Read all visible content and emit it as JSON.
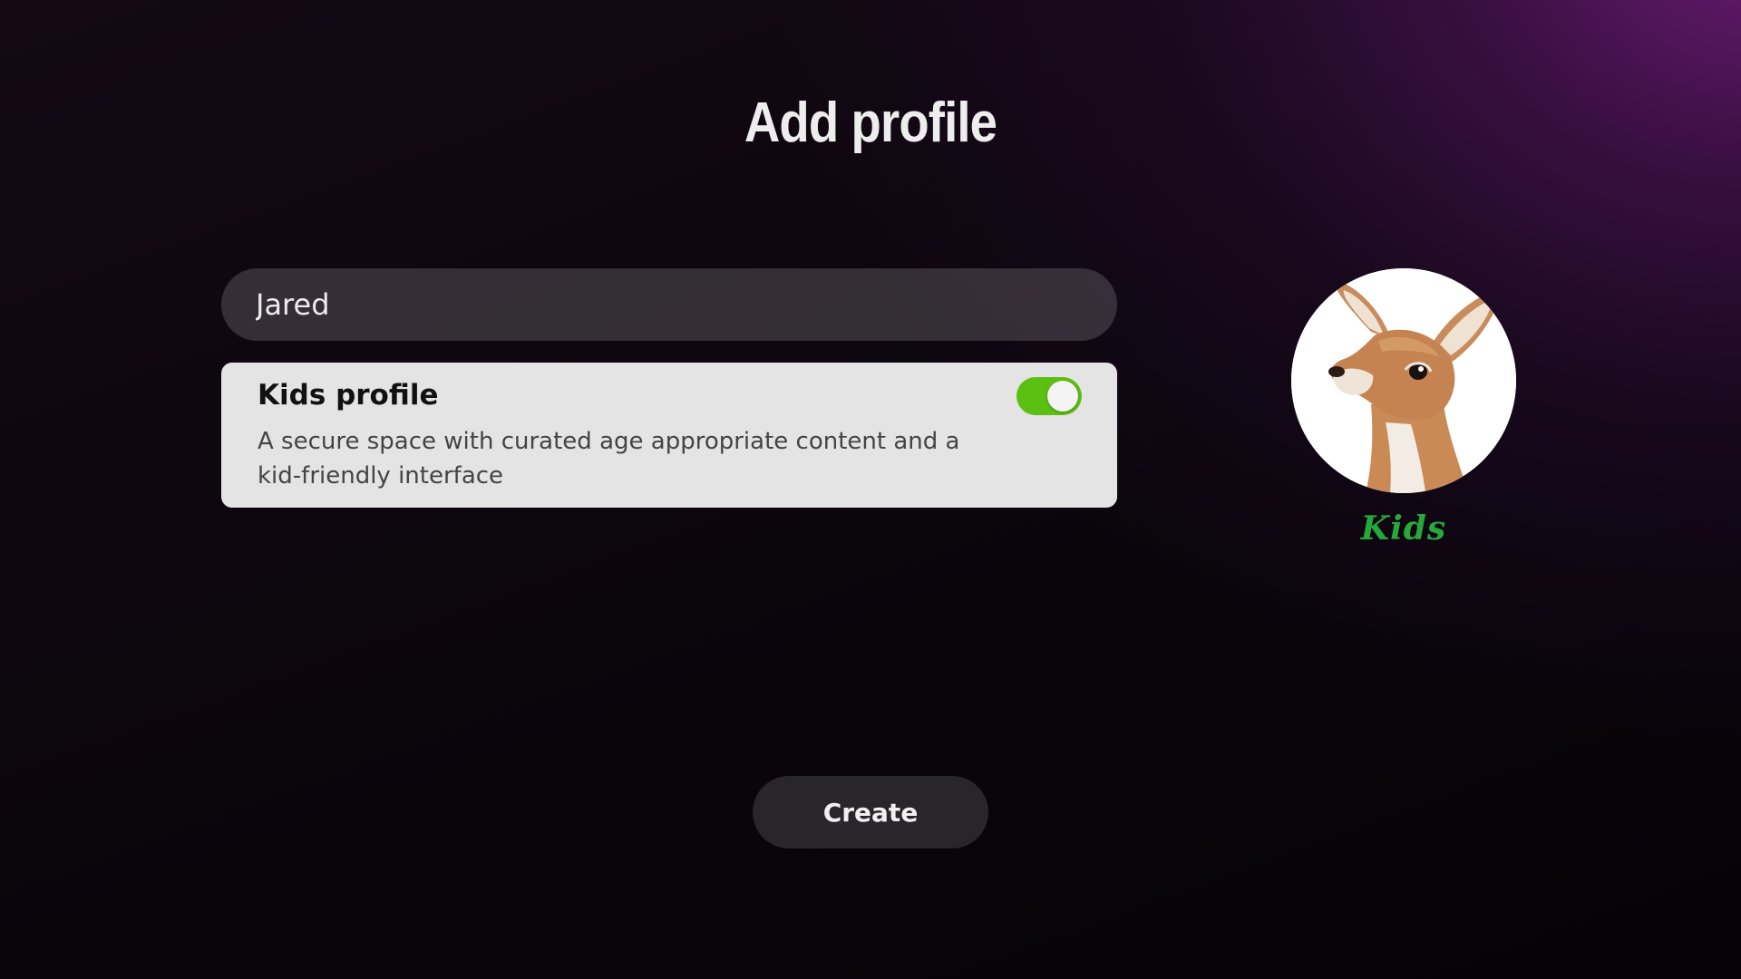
{
  "page": {
    "title": "Add profile"
  },
  "name_field": {
    "value": "Jared"
  },
  "kids_profile": {
    "title": "Kids profile",
    "description": "A secure space with curated age appropriate content and a kid-friendly interface",
    "toggle_on": true,
    "toggle_color": "#5cc012"
  },
  "avatar": {
    "icon": "fawn-avatar-icon",
    "label": "Kids",
    "label_color": "#27a83a"
  },
  "actions": {
    "create_label": "Create"
  }
}
